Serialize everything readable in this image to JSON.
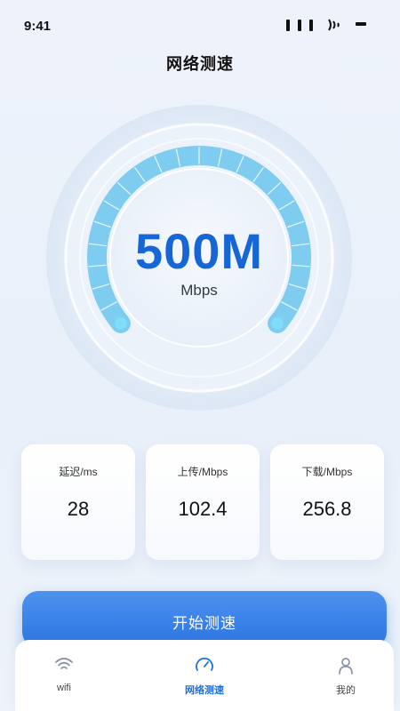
{
  "status_bar": {
    "time": "9:41"
  },
  "header": {
    "title": "网络测速"
  },
  "gauge": {
    "value": "500M",
    "unit": "Mbps"
  },
  "stats": [
    {
      "label": "延迟/ms",
      "value": "28"
    },
    {
      "label": "上传/Mbps",
      "value": "102.4"
    },
    {
      "label": "下载/Mbps",
      "value": "256.8"
    }
  ],
  "actions": {
    "start_label": "开始测速"
  },
  "tabs": [
    {
      "label": "wifi",
      "icon": "wifi-icon",
      "active": false
    },
    {
      "label": "网络测速",
      "icon": "speedometer-icon",
      "active": true
    },
    {
      "label": "我的",
      "icon": "user-icon",
      "active": false
    }
  ],
  "colors": {
    "accent": "#2b75e4",
    "speed_text": "#1766d6",
    "gauge_fill": "#6cc6ee"
  }
}
